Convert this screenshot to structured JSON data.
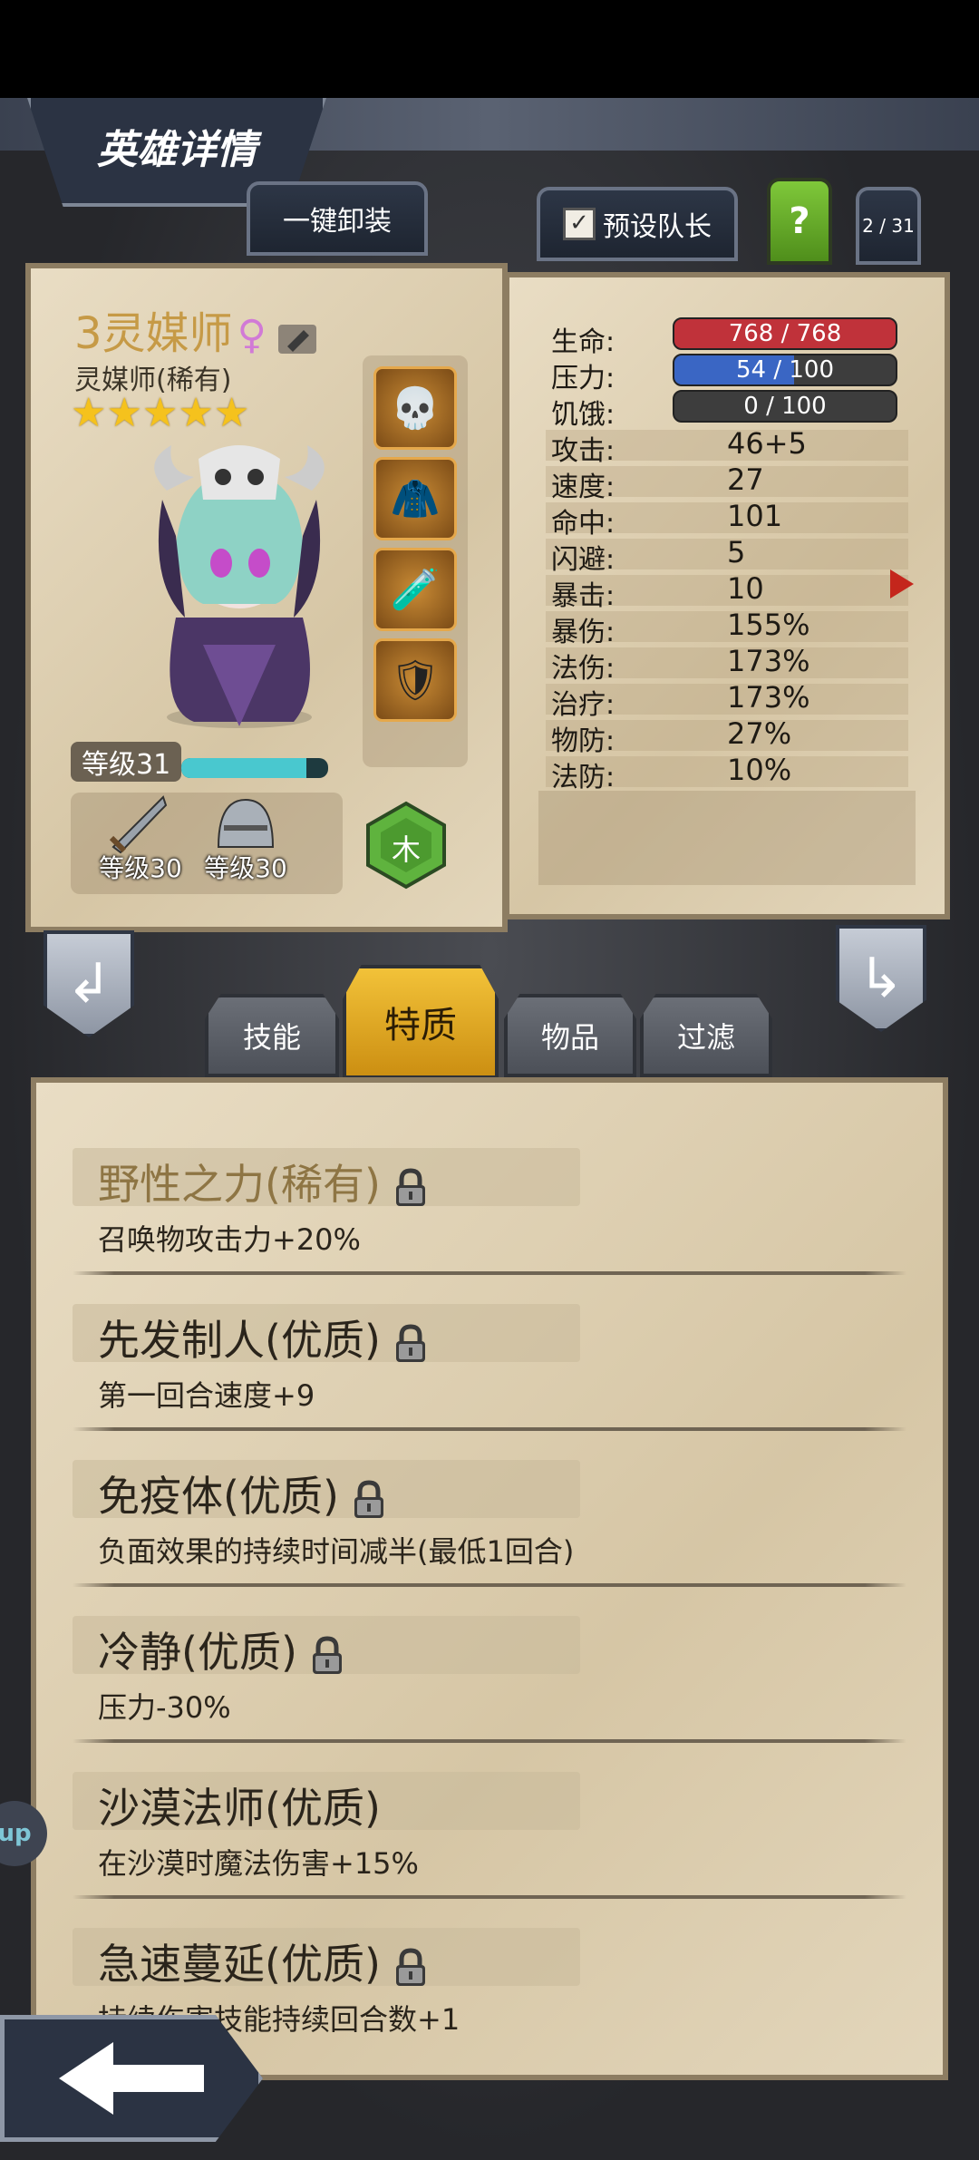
{
  "header": {
    "title": "英雄详情"
  },
  "toolbar": {
    "unequip_all": "一键卸装",
    "preset_leader": "预设队长",
    "preset_checked": "✓",
    "help": "?",
    "page_counter": "2 / 31"
  },
  "hero": {
    "name": "3灵媒师",
    "gender": "♀",
    "class": "灵媒师(稀有)",
    "stars": 5,
    "level_label": "等级31",
    "xp_fraction": 0.85,
    "element": "木",
    "gear": [
      {
        "icon": "sword-icon",
        "level": "等级30"
      },
      {
        "icon": "helmet-icon",
        "level": "等级30"
      }
    ],
    "slots": [
      "skull-cloak-icon",
      "hood-icon",
      "potion-icon",
      "shield-icon"
    ]
  },
  "stats": {
    "hp": {
      "label": "生命:",
      "value": "768 / 768",
      "fraction": 1.0,
      "color": "#c0323a"
    },
    "stress": {
      "label": "压力:",
      "value": "54 / 100",
      "fraction": 0.54,
      "color": "#3a66c4"
    },
    "hunger": {
      "label": "饥饿:",
      "value": "0 / 100",
      "fraction": 0.0,
      "color": "#3d3d3d"
    },
    "rows": [
      {
        "label": "攻击:",
        "value": "46+5"
      },
      {
        "label": "速度:",
        "value": "27"
      },
      {
        "label": "命中:",
        "value": "101"
      },
      {
        "label": "闪避:",
        "value": "5"
      },
      {
        "label": "暴击:",
        "value": "10"
      },
      {
        "label": "暴伤:",
        "value": "155%"
      },
      {
        "label": "法伤:",
        "value": "173%"
      },
      {
        "label": "治疗:",
        "value": "173%"
      },
      {
        "label": "物防:",
        "value": "27%"
      },
      {
        "label": "法防:",
        "value": "10%"
      }
    ]
  },
  "tabs": [
    {
      "label": "技能",
      "active": false
    },
    {
      "label": "特质",
      "active": true
    },
    {
      "label": "物品",
      "active": false
    },
    {
      "label": "过滤",
      "active": false
    }
  ],
  "traits": [
    {
      "title": "野性之力(稀有)",
      "desc": "召唤物攻击力+20%",
      "locked": true,
      "rare": true
    },
    {
      "title": "先发制人(优质)",
      "desc": "第一回合速度+9",
      "locked": true,
      "rare": false
    },
    {
      "title": "免疫体(优质)",
      "desc": "负面效果的持续时间减半(最低1回合)",
      "locked": true,
      "rare": false
    },
    {
      "title": "冷静(优质)",
      "desc": "压力-30%",
      "locked": true,
      "rare": false
    },
    {
      "title": "沙漠法师(优质)",
      "desc": "在沙漠时魔法伤害+15%",
      "locked": false,
      "rare": false
    },
    {
      "title": "急速蔓延(优质)",
      "desc": "持续伤害技能持续回合数+1",
      "locked": true,
      "rare": false
    }
  ],
  "side_badge": "up"
}
